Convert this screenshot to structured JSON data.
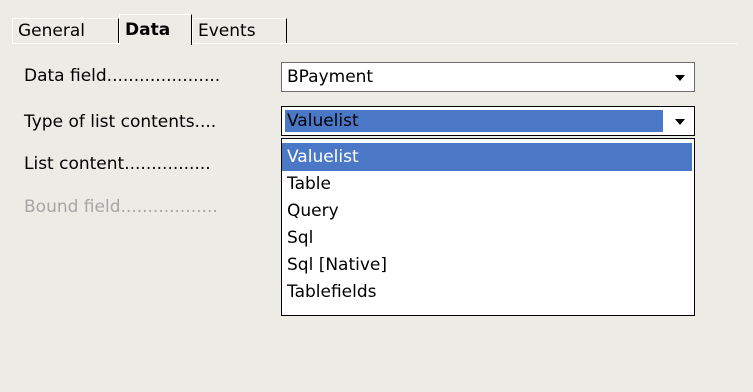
{
  "tabs": [
    {
      "label": "General"
    },
    {
      "label": "Data"
    },
    {
      "label": "Events"
    }
  ],
  "fields": {
    "data_field": {
      "label": "Data field.....................",
      "value": "BPayment"
    },
    "type_of_list_contents": {
      "label": "Type of list contents....",
      "value": "Valuelist"
    },
    "list_content": {
      "label": "List content................"
    },
    "bound_field": {
      "label": "Bound field.................."
    }
  },
  "list_options": [
    "Valuelist",
    "Table",
    "Query",
    "Sql",
    "Sql [Native]",
    "Tablefields"
  ],
  "selected_option": "Valuelist",
  "colors": {
    "selection": "#4a78c7",
    "background": "#ecebe6",
    "disabled_text": "#a6a6a6"
  },
  "icons": {
    "dropdown": "chevron-down-icon"
  }
}
